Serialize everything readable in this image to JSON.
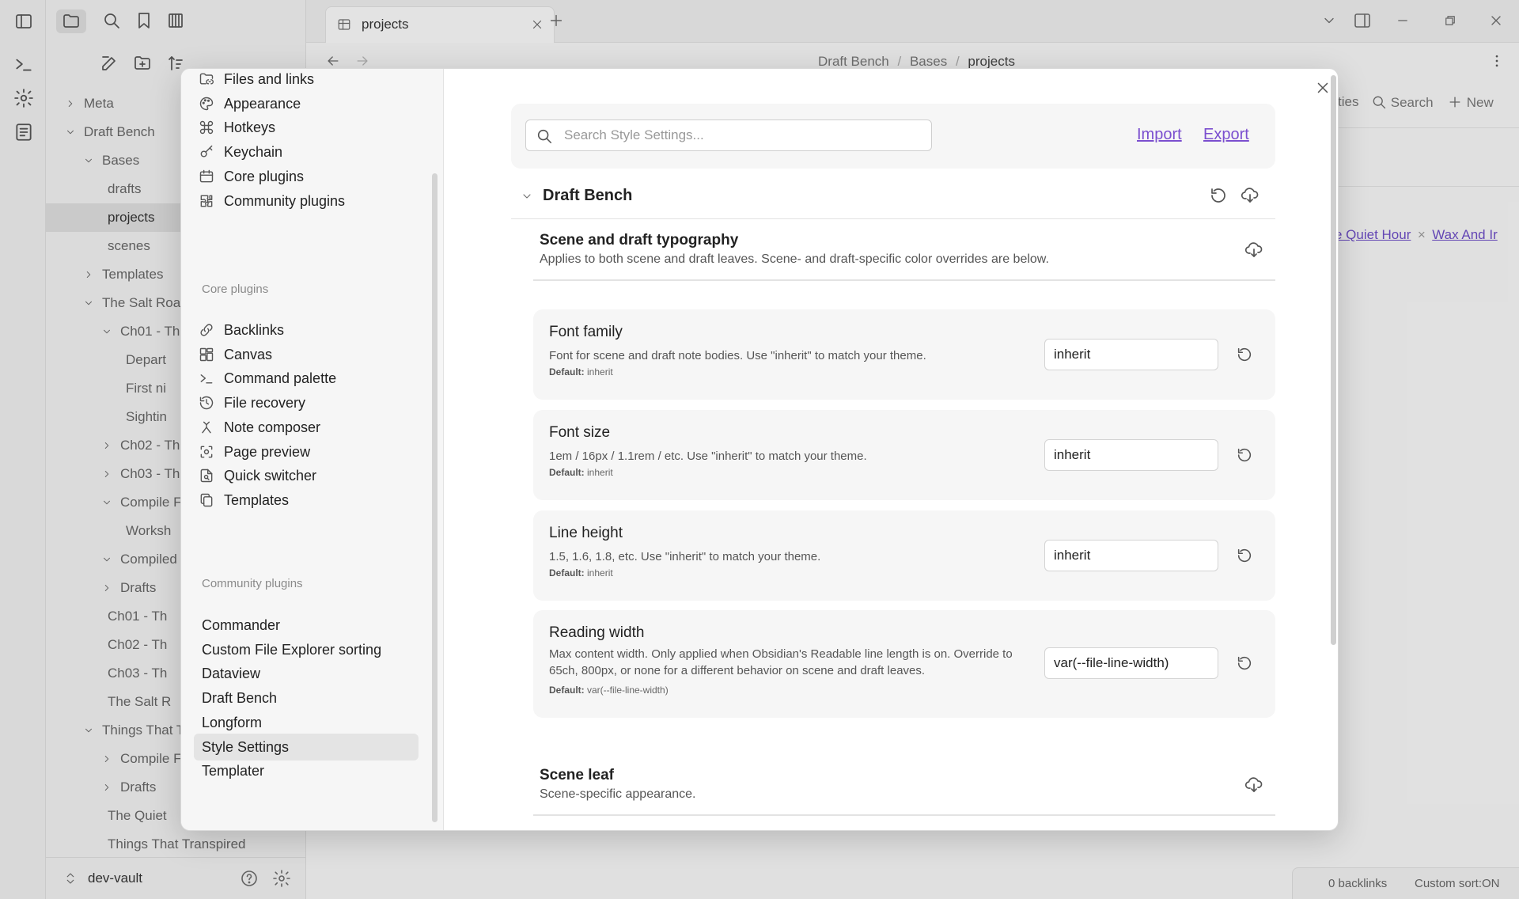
{
  "app": {
    "tab_title": "projects",
    "breadcrumb": [
      "Draft Bench",
      "Bases",
      "projects"
    ],
    "vault_name": "dev-vault"
  },
  "file_tree": [
    {
      "label": "Meta",
      "depth": 0,
      "state": "collapsed"
    },
    {
      "label": "Draft Bench",
      "depth": 0,
      "state": "expanded"
    },
    {
      "label": "Bases",
      "depth": 1,
      "state": "expanded"
    },
    {
      "label": "drafts",
      "depth": 2,
      "state": "file"
    },
    {
      "label": "projects",
      "depth": 2,
      "state": "file",
      "selected": true
    },
    {
      "label": "scenes",
      "depth": 2,
      "state": "file"
    },
    {
      "label": "Templates",
      "depth": 1,
      "state": "collapsed"
    },
    {
      "label": "The Salt Road",
      "depth": 1,
      "state": "expanded"
    },
    {
      "label": "Ch01 - Th",
      "depth": 2,
      "state": "expanded"
    },
    {
      "label": "Depart",
      "depth": 3,
      "state": "file"
    },
    {
      "label": "First ni",
      "depth": 3,
      "state": "file"
    },
    {
      "label": "Sightin",
      "depth": 3,
      "state": "file"
    },
    {
      "label": "Ch02 - Th",
      "depth": 2,
      "state": "collapsed"
    },
    {
      "label": "Ch03 - Th",
      "depth": 2,
      "state": "collapsed"
    },
    {
      "label": "Compile F",
      "depth": 2,
      "state": "expanded"
    },
    {
      "label": "Worksh",
      "depth": 3,
      "state": "file"
    },
    {
      "label": "Compiled",
      "depth": 2,
      "state": "expanded"
    },
    {
      "label": "Drafts",
      "depth": 2,
      "state": "collapsed"
    },
    {
      "label": "Ch01 - Th",
      "depth": 2,
      "state": "file"
    },
    {
      "label": "Ch02 - Th",
      "depth": 2,
      "state": "file"
    },
    {
      "label": "Ch03 - Th",
      "depth": 2,
      "state": "file"
    },
    {
      "label": "The Salt R",
      "depth": 2,
      "state": "file"
    },
    {
      "label": "Things That T",
      "depth": 1,
      "state": "expanded"
    },
    {
      "label": "Compile F",
      "depth": 2,
      "state": "collapsed"
    },
    {
      "label": "Drafts",
      "depth": 2,
      "state": "collapsed"
    },
    {
      "label": "The Quiet",
      "depth": 2,
      "state": "file"
    },
    {
      "label": "Things That Transpired",
      "depth": 2,
      "state": "file"
    }
  ],
  "main_toolbar": {
    "properties_partial": "ties",
    "search": "Search",
    "new": "New"
  },
  "links_row": {
    "link1": "e Quiet Hour",
    "link2": "Wax And Ir"
  },
  "status_bar": {
    "backlinks": "0 backlinks",
    "sort": "Custom sort:ON"
  },
  "settings_nav": {
    "options": [
      {
        "label": "Files and links",
        "icon": "folder-link-icon"
      },
      {
        "label": "Appearance",
        "icon": "palette-icon"
      },
      {
        "label": "Hotkeys",
        "icon": "command-icon"
      },
      {
        "label": "Keychain",
        "icon": "key-icon"
      },
      {
        "label": "Core plugins",
        "icon": "calendar-box-icon"
      },
      {
        "label": "Community plugins",
        "icon": "puzzle-icon"
      }
    ],
    "core_heading": "Core plugins",
    "core": [
      {
        "label": "Backlinks",
        "icon": "backlinks-icon"
      },
      {
        "label": "Canvas",
        "icon": "canvas-icon"
      },
      {
        "label": "Command palette",
        "icon": "terminal-icon"
      },
      {
        "label": "File recovery",
        "icon": "history-icon"
      },
      {
        "label": "Note composer",
        "icon": "merge-icon"
      },
      {
        "label": "Page preview",
        "icon": "preview-icon"
      },
      {
        "label": "Quick switcher",
        "icon": "file-search-icon"
      },
      {
        "label": "Templates",
        "icon": "files-icon"
      }
    ],
    "community_heading": "Community plugins",
    "community": [
      "Commander",
      "Custom File Explorer sorting",
      "Dataview",
      "Draft Bench",
      "Longform",
      "Style Settings",
      "Templater"
    ],
    "active": "Style Settings"
  },
  "style_settings": {
    "search_placeholder": "Search Style Settings...",
    "import": "Import",
    "export": "Export",
    "section_title": "Draft Bench",
    "group": {
      "title": "Scene and draft typography",
      "desc": "Applies to both scene and draft leaves. Scene- and draft-specific color overrides are below."
    },
    "settings": [
      {
        "name": "Font family",
        "desc": "Font for scene and draft note bodies. Use \"inherit\" to match your theme.",
        "default_label": "Default:",
        "default": "inherit",
        "value": "inherit"
      },
      {
        "name": "Font size",
        "desc": "1em / 16px / 1.1rem / etc. Use \"inherit\" to match your theme.",
        "default_label": "Default:",
        "default": "inherit",
        "value": "inherit"
      },
      {
        "name": "Line height",
        "desc": "1.5, 1.6, 1.8, etc. Use \"inherit\" to match your theme.",
        "default_label": "Default:",
        "default": "inherit",
        "value": "inherit"
      },
      {
        "name": "Reading width",
        "desc": "Max content width. Only applied when Obsidian's Readable line length is on. Override to 65ch, 800px, or none for a different behavior on scene and draft leaves.",
        "default_label": "Default:",
        "default": "var(--file-line-width)",
        "value": "var(--file-line-width)"
      }
    ],
    "group2": {
      "title": "Scene leaf",
      "desc": "Scene-specific appearance."
    }
  }
}
